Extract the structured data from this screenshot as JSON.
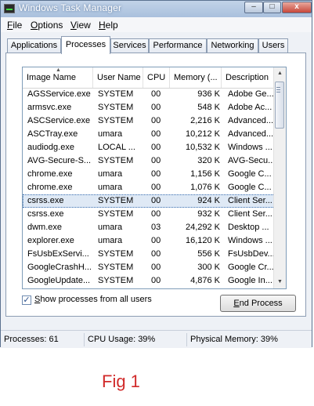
{
  "window": {
    "title": "Windows Task Manager",
    "min_glyph": "–",
    "max_glyph": "□",
    "close_glyph": "x"
  },
  "menu": [
    {
      "accel": "F",
      "rest": "ile"
    },
    {
      "accel": "O",
      "rest": "ptions"
    },
    {
      "accel": "V",
      "rest": "iew"
    },
    {
      "accel": "H",
      "rest": "elp"
    }
  ],
  "tabs": [
    "Applications",
    "Processes",
    "Services",
    "Performance",
    "Networking",
    "Users"
  ],
  "active_tab": "Processes",
  "columns": {
    "image_name": "Image Name",
    "user_name": "User Name",
    "cpu": "CPU",
    "memory": "Memory (...",
    "description": "Description"
  },
  "rows": [
    {
      "image": "AGSService.exe",
      "user": "SYSTEM",
      "cpu": "00",
      "mem": "936 K",
      "desc": "Adobe Ge..."
    },
    {
      "image": "armsvc.exe",
      "user": "SYSTEM",
      "cpu": "00",
      "mem": "548 K",
      "desc": "Adobe Ac..."
    },
    {
      "image": "ASCService.exe",
      "user": "SYSTEM",
      "cpu": "00",
      "mem": "2,216 K",
      "desc": "Advanced..."
    },
    {
      "image": "ASCTray.exe",
      "user": "umara",
      "cpu": "00",
      "mem": "10,212 K",
      "desc": "Advanced..."
    },
    {
      "image": "audiodg.exe",
      "user": "LOCAL ...",
      "cpu": "00",
      "mem": "10,532 K",
      "desc": "Windows ..."
    },
    {
      "image": "AVG-Secure-S...",
      "user": "SYSTEM",
      "cpu": "00",
      "mem": "320 K",
      "desc": "AVG-Secu..."
    },
    {
      "image": "chrome.exe",
      "user": "umara",
      "cpu": "00",
      "mem": "1,156 K",
      "desc": "Google C..."
    },
    {
      "image": "chrome.exe",
      "user": "umara",
      "cpu": "00",
      "mem": "1,076 K",
      "desc": "Google C..."
    },
    {
      "image": "csrss.exe",
      "user": "SYSTEM",
      "cpu": "00",
      "mem": "924 K",
      "desc": "Client Ser..."
    },
    {
      "image": "csrss.exe",
      "user": "SYSTEM",
      "cpu": "00",
      "mem": "932 K",
      "desc": "Client Ser..."
    },
    {
      "image": "dwm.exe",
      "user": "umara",
      "cpu": "03",
      "mem": "24,292 K",
      "desc": "Desktop ..."
    },
    {
      "image": "explorer.exe",
      "user": "umara",
      "cpu": "00",
      "mem": "16,120 K",
      "desc": "Windows ..."
    },
    {
      "image": "FsUsbExServi...",
      "user": "SYSTEM",
      "cpu": "00",
      "mem": "556 K",
      "desc": "FsUsbDev..."
    },
    {
      "image": "GoogleCrashH...",
      "user": "SYSTEM",
      "cpu": "00",
      "mem": "300 K",
      "desc": "Google Cr..."
    },
    {
      "image": "GoogleUpdate...",
      "user": "SYSTEM",
      "cpu": "00",
      "mem": "4,876 K",
      "desc": "Google In..."
    }
  ],
  "selected_row": 8,
  "show_all_users": {
    "checked": true,
    "check_glyph": "✓",
    "accel": "S",
    "rest": "how processes from all users"
  },
  "end_process": {
    "accel": "E",
    "rest": "nd Process"
  },
  "status": {
    "processes": "Processes: 61",
    "cpu_usage": "CPU Usage: 39%",
    "physical_memory": "Physical Memory: 39%"
  },
  "caption": "Fig 1",
  "colors": {
    "caption": "#d12a2a",
    "title_gradient_top": "#c2d3e8",
    "selection": "#dfe9f5"
  }
}
